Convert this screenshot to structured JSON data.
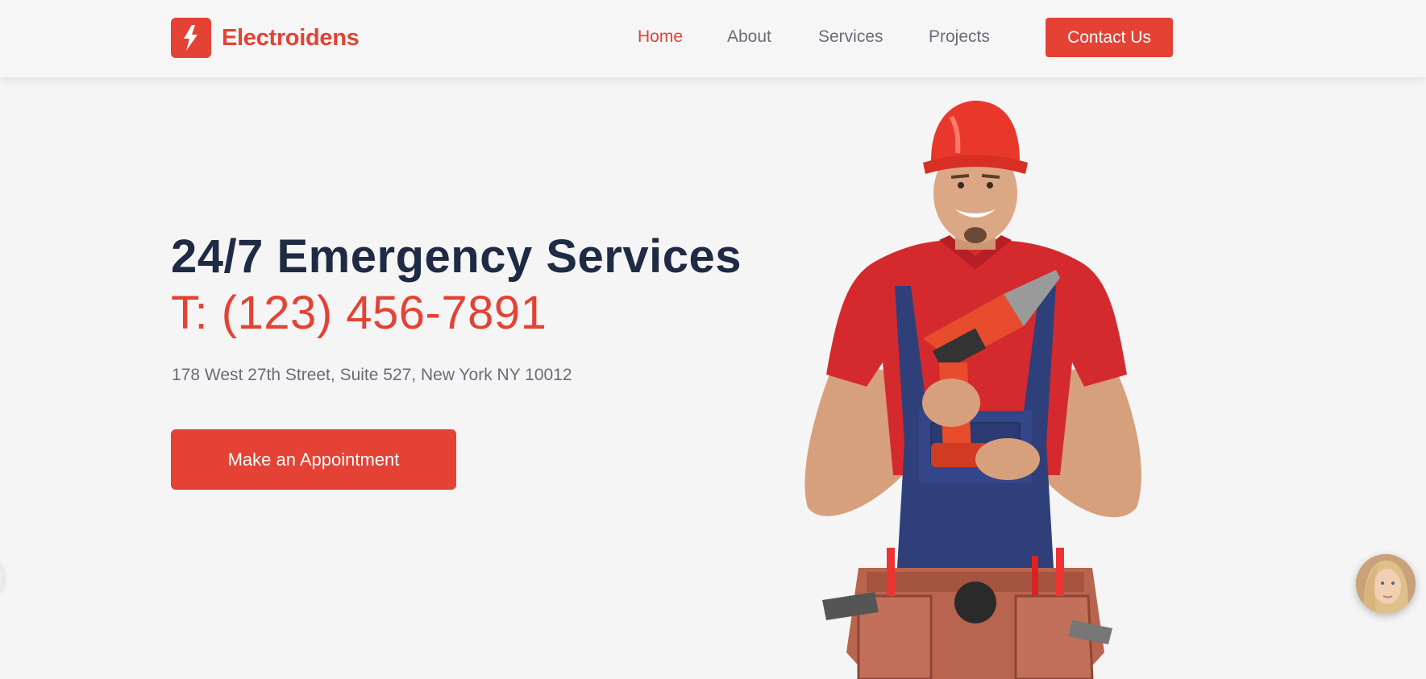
{
  "brand": {
    "name": "Electroidens",
    "logo_icon": "lightning-bolt-icon",
    "accent_color": "#e34234",
    "dark_text_color": "#1f2a44"
  },
  "nav": {
    "items": [
      {
        "label": "Home",
        "active": true
      },
      {
        "label": "About",
        "active": false
      },
      {
        "label": "Services",
        "active": false
      },
      {
        "label": "Projects",
        "active": false
      }
    ],
    "cta_label": "Contact Us"
  },
  "hero": {
    "title": "24/7 Emergency Services",
    "phone": "T: (123) 456-7891",
    "address": "178 West 27th Street, Suite 527, New York NY 10012",
    "button_label": "Make an Appointment"
  },
  "chat_widget": {
    "icon": "support-agent-avatar"
  }
}
